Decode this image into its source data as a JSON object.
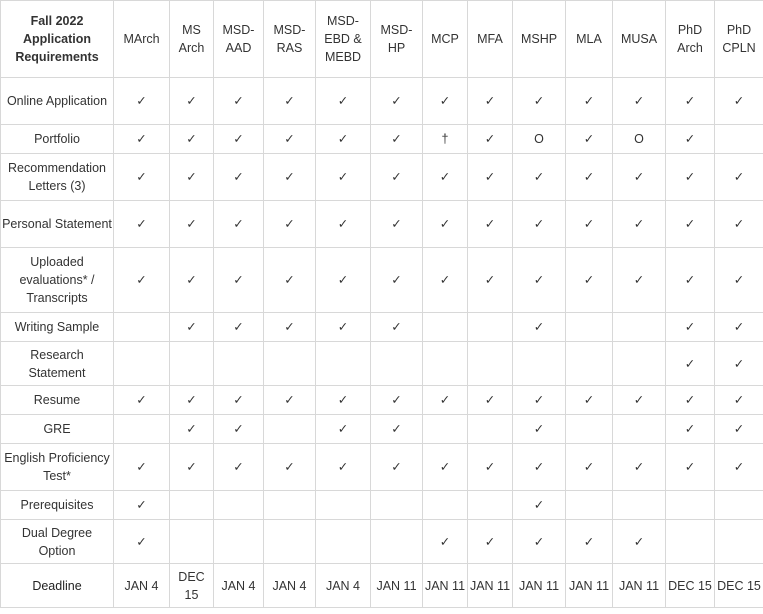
{
  "table": {
    "corner_label": "Fall 2022 Application Requirements",
    "columns": [
      "MArch",
      "MS Arch",
      "MSD-AAD",
      "MSD-RAS",
      "MSD-EBD & MEBD",
      "MSD-HP",
      "MCP",
      "MFA",
      "MSHP",
      "MLA",
      "MUSA",
      "PhD Arch",
      "PhD CPLN"
    ],
    "rows": [
      {
        "label": "Online Application",
        "cells": [
          "✓",
          "✓",
          "✓",
          "✓",
          "✓",
          "✓",
          "✓",
          "✓",
          "✓",
          "✓",
          "✓",
          "✓",
          "✓"
        ]
      },
      {
        "label": "Portfolio",
        "cells": [
          "✓",
          "✓",
          "✓",
          "✓",
          "✓",
          "✓",
          "†",
          "✓",
          "O",
          "✓",
          "O",
          "✓",
          ""
        ]
      },
      {
        "label": "Recommendation Letters (3)",
        "cells": [
          "✓",
          "✓",
          "✓",
          "✓",
          "✓",
          "✓",
          "✓",
          "✓",
          "✓",
          "✓",
          "✓",
          "✓",
          "✓"
        ]
      },
      {
        "label": "Personal Statement",
        "cells": [
          "✓",
          "✓",
          "✓",
          "✓",
          "✓",
          "✓",
          "✓",
          "✓",
          "✓",
          "✓",
          "✓",
          "✓",
          "✓"
        ]
      },
      {
        "label": "Uploaded evaluations* / Transcripts",
        "cells": [
          "✓",
          "✓",
          "✓",
          "✓",
          "✓",
          "✓",
          "✓",
          "✓",
          "✓",
          "✓",
          "✓",
          "✓",
          "✓"
        ]
      },
      {
        "label": "Writing Sample",
        "cells": [
          "",
          "✓",
          "✓",
          "✓",
          "✓",
          "✓",
          "",
          "",
          "✓",
          "",
          "",
          "✓",
          "✓"
        ]
      },
      {
        "label": "Research Statement",
        "cells": [
          "",
          "",
          "",
          "",
          "",
          "",
          "",
          "",
          "",
          "",
          "",
          "✓",
          "✓"
        ]
      },
      {
        "label": "Resume",
        "cells": [
          "✓",
          "✓",
          "✓",
          "✓",
          "✓",
          "✓",
          "✓",
          "✓",
          "✓",
          "✓",
          "✓",
          "✓",
          "✓"
        ]
      },
      {
        "label": "GRE",
        "cells": [
          "",
          "✓",
          "✓",
          "",
          "✓",
          "✓",
          "",
          "",
          "✓",
          "",
          "",
          "✓",
          "✓"
        ]
      },
      {
        "label": "English Proficiency Test*",
        "cells": [
          "✓",
          "✓",
          "✓",
          "✓",
          "✓",
          "✓",
          "✓",
          "✓",
          "✓",
          "✓",
          "✓",
          "✓",
          "✓"
        ]
      },
      {
        "label": "Prerequisites",
        "cells": [
          "✓",
          "",
          "",
          "",
          "",
          "",
          "",
          "",
          "✓",
          "",
          "",
          "",
          ""
        ]
      },
      {
        "label": "Dual Degree Option",
        "cells": [
          "✓",
          "",
          "",
          "",
          "",
          "",
          "✓",
          "✓",
          "✓",
          "✓",
          "✓",
          "",
          ""
        ]
      }
    ],
    "deadline": {
      "label": "Deadline",
      "cells": [
        "JAN 4",
        "DEC 15",
        "JAN 4",
        "JAN 4",
        "JAN 4",
        "JAN 11",
        "JAN 11",
        "JAN 11",
        "JAN 11",
        "JAN 11",
        "JAN 11",
        "DEC 15",
        "DEC 15"
      ]
    }
  }
}
